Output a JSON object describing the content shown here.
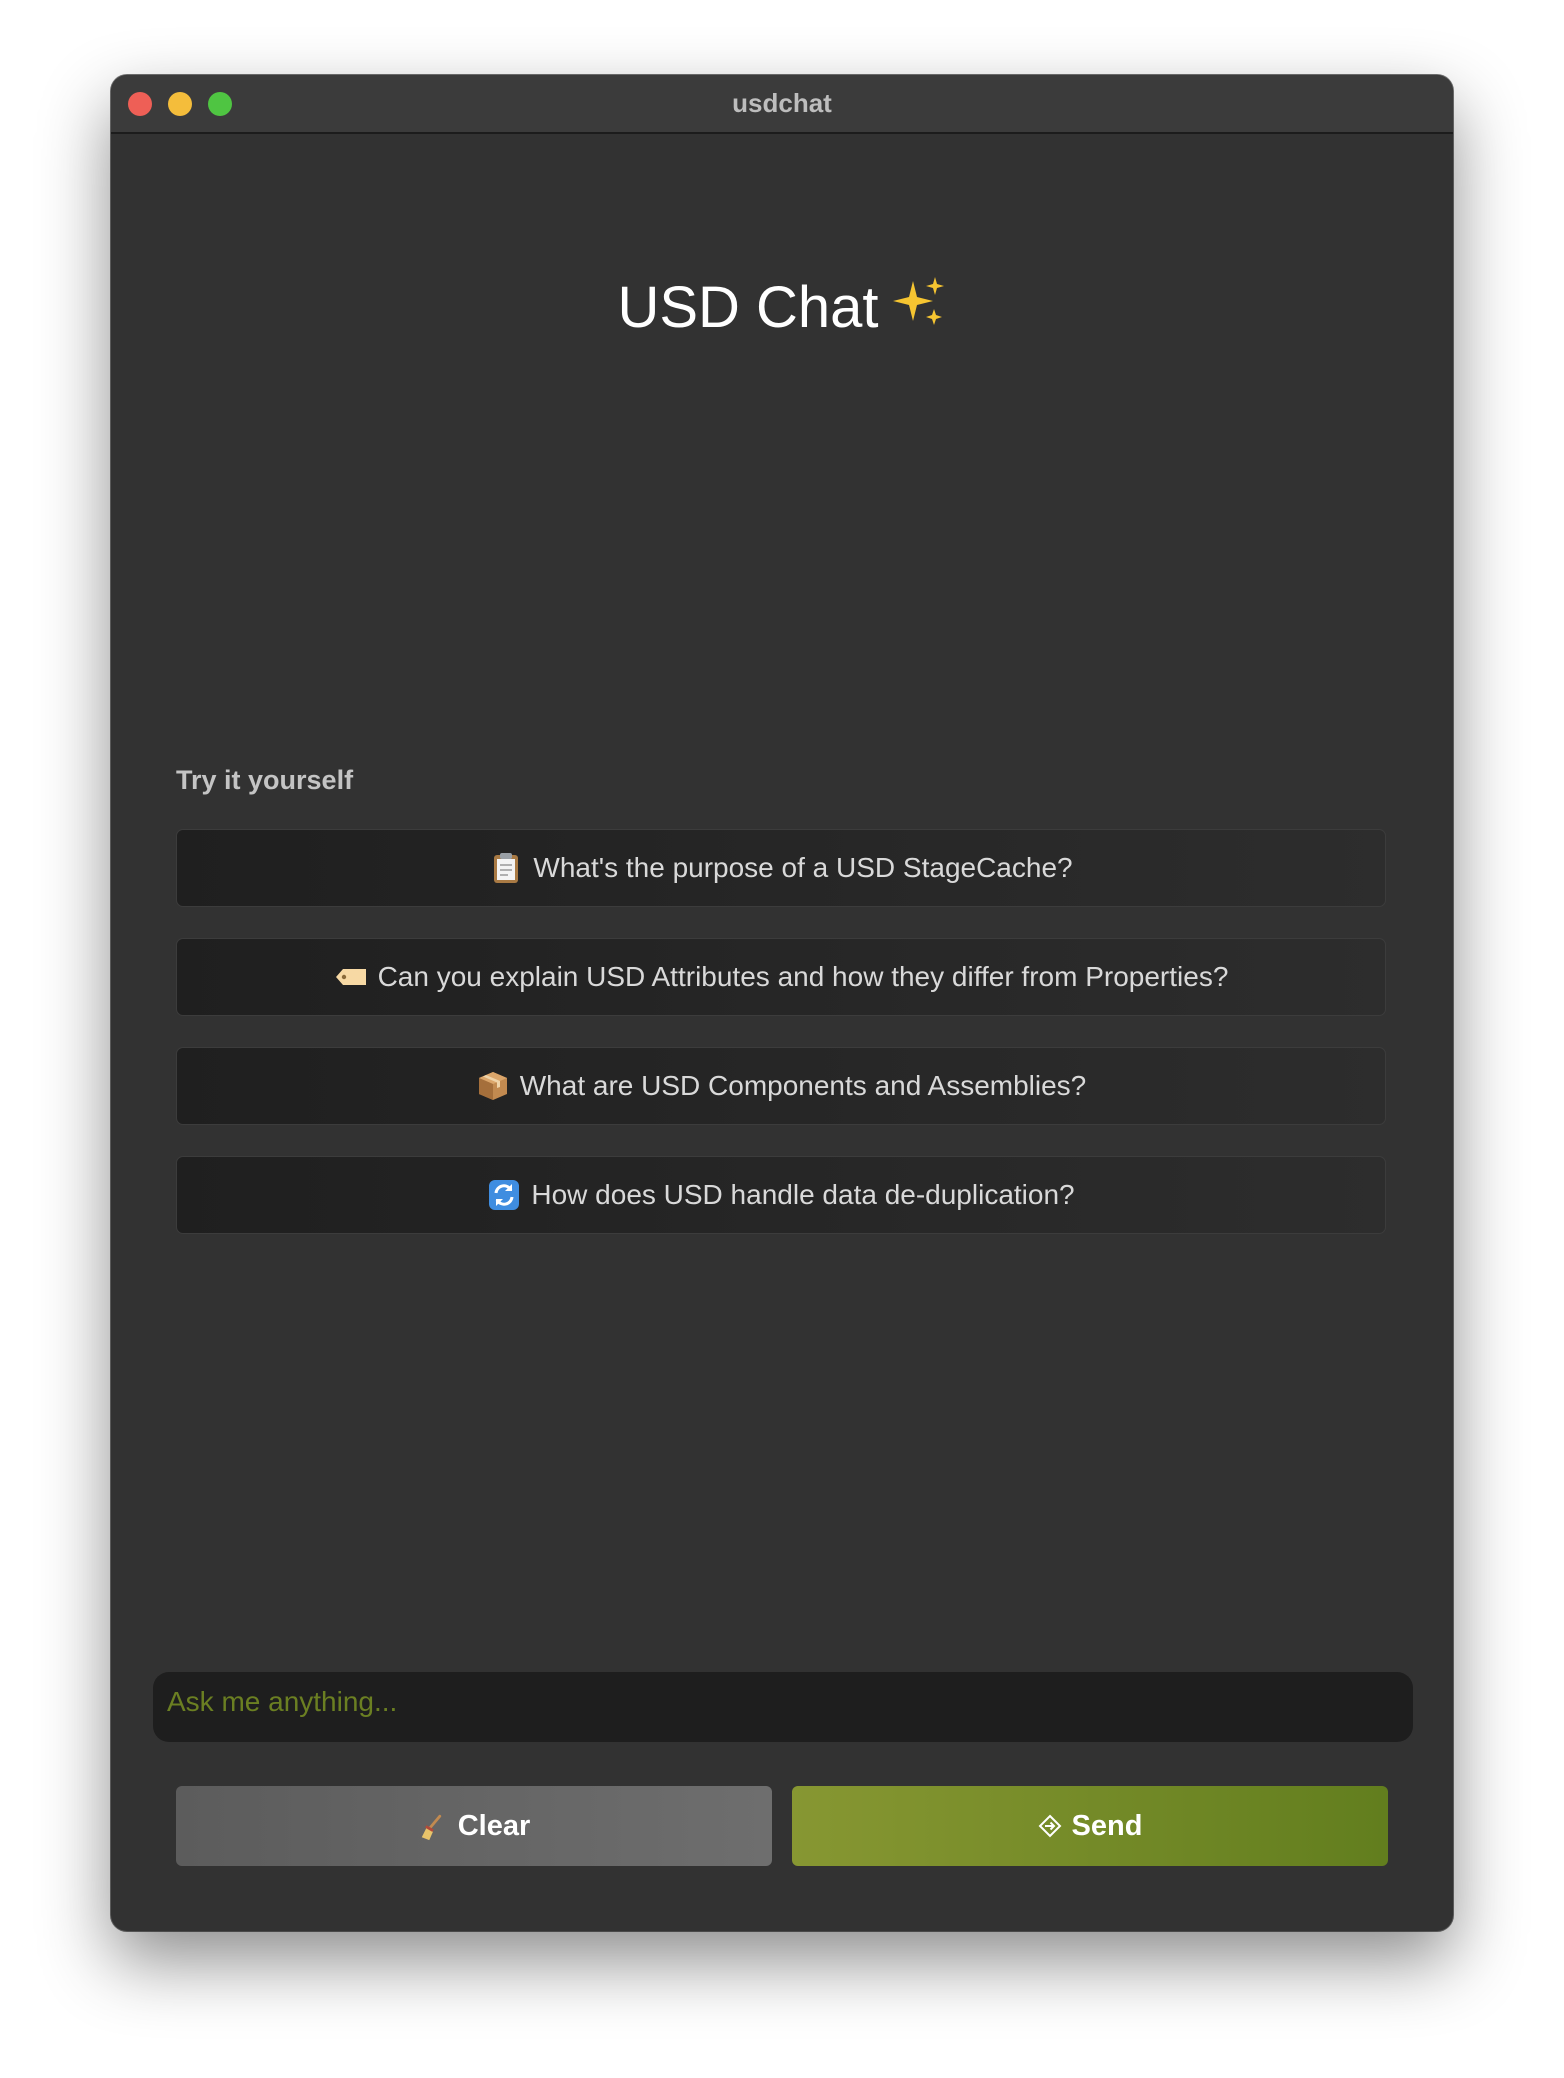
{
  "window": {
    "title": "usdchat",
    "controls": [
      "close",
      "minimize",
      "zoom"
    ]
  },
  "header": {
    "title": "USD Chat",
    "title_icon": "sparkles-icon"
  },
  "suggestions": {
    "label": "Try it yourself",
    "items": [
      {
        "icon": "clipboard-icon",
        "text": "What's the purpose of a USD StageCache?"
      },
      {
        "icon": "label-tag-icon",
        "text": "Can you explain USD Attributes and how they differ from Properties?"
      },
      {
        "icon": "package-icon",
        "text": "What are USD Components and Assemblies?"
      },
      {
        "icon": "refresh-icon",
        "text": "How does USD handle data de-duplication?"
      }
    ]
  },
  "input": {
    "value": "",
    "placeholder": "Ask me anything..."
  },
  "actions": {
    "clear_label": "Clear",
    "clear_icon": "broom-icon",
    "send_label": "Send",
    "send_icon": "diamond-arrow-icon"
  },
  "colors": {
    "window_bg": "#323232",
    "titlebar_bg": "#3b3b3b",
    "send_accent": "#7a8c2a",
    "clear_bg": "#666666",
    "placeholder": "#6b7f22"
  }
}
